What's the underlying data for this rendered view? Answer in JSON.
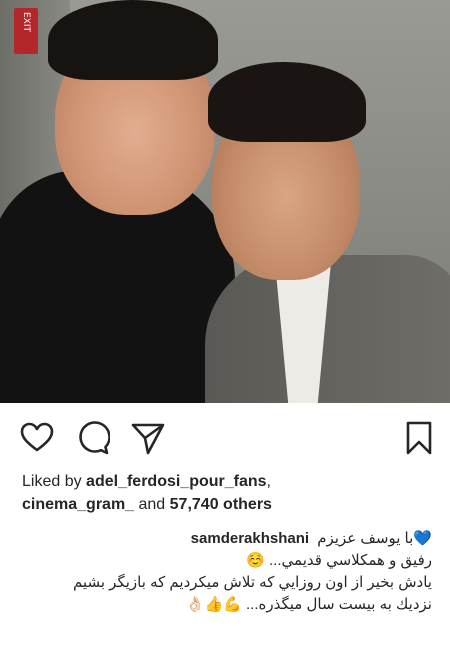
{
  "post": {
    "photo_alt": "",
    "sign_text": "EXIT"
  },
  "actions": {
    "like_icon": "heart-outline-icon",
    "comment_icon": "comment-bubble-icon",
    "share_icon": "paper-plane-icon",
    "save_icon": "bookmark-icon"
  },
  "likes": {
    "prefix": "Liked by ",
    "user1": "adel_ferdosi_pour_fans",
    "sep1": ",",
    "user2": "cinema_gram_",
    "and": " and ",
    "others": "57,740 others"
  },
  "caption": {
    "username": "samderakhshani",
    "line1": "با يوسف عزيزم💙",
    "line2": "رفيق و همكلاسي قديمي... ☺️",
    "line3": "يادش بخير از اون روزايي كه تلاش ميكرديم كه بازيگر بشيم",
    "line4": "نزديك به بيست سال ميگذره... 💪👍👌🏻"
  },
  "colors": {
    "text": "#262626",
    "background": "#ffffff",
    "icon": "#262626"
  }
}
